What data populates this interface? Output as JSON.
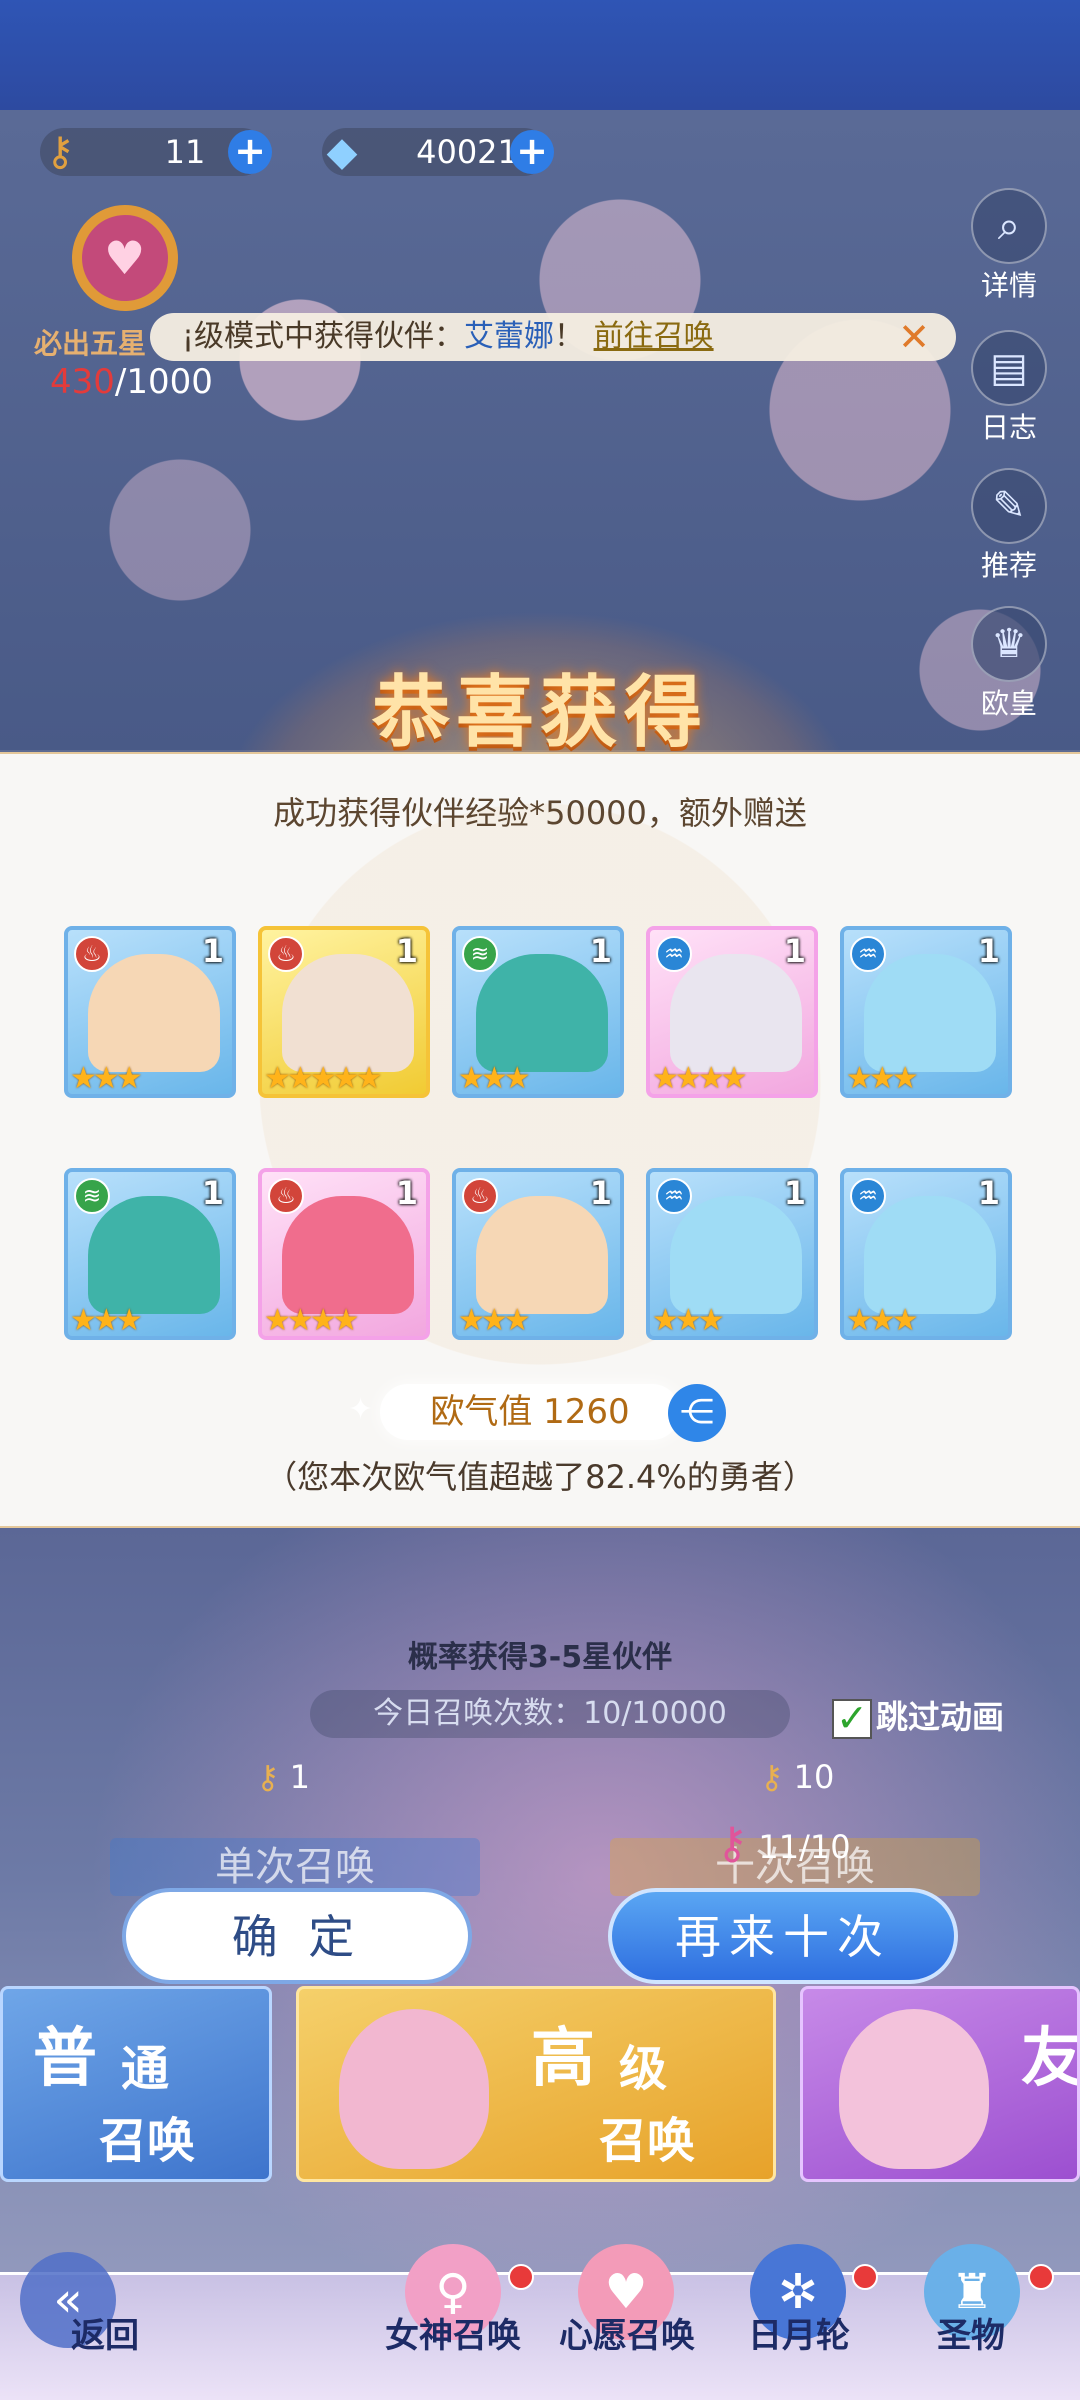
{
  "resources": {
    "summon_ticket": "11",
    "currency": "40021"
  },
  "pity": {
    "label": "必出五星",
    "current": "430",
    "total": "/1000"
  },
  "banner": {
    "prefix": "¡级模式中获得伙伴：",
    "name": "艾蕾娜",
    "exclaim": "！",
    "link": "前往召唤"
  },
  "side_buttons": [
    "详情",
    "日志",
    "推荐",
    "欧皇"
  ],
  "title": "恭喜获得",
  "subtitle": "成功获得伙伴经验*50000，额外赠送",
  "cards": [
    {
      "element": "fire",
      "count": "1",
      "stars": 3,
      "frame": "blue"
    },
    {
      "element": "fire",
      "count": "1",
      "stars": 5,
      "frame": "gold"
    },
    {
      "element": "wind",
      "count": "1",
      "stars": 3,
      "frame": "blue"
    },
    {
      "element": "water",
      "count": "1",
      "stars": 4,
      "frame": "pink"
    },
    {
      "element": "water",
      "count": "1",
      "stars": 3,
      "frame": "blue"
    },
    {
      "element": "wind",
      "count": "1",
      "stars": 3,
      "frame": "blue"
    },
    {
      "element": "fire",
      "count": "1",
      "stars": 4,
      "frame": "pink"
    },
    {
      "element": "fire",
      "count": "1",
      "stars": 3,
      "frame": "blue"
    },
    {
      "element": "water",
      "count": "1",
      "stars": 3,
      "frame": "blue"
    },
    {
      "element": "water",
      "count": "1",
      "stars": 3,
      "frame": "blue"
    }
  ],
  "luck": {
    "label": "欧气值",
    "value": "1260",
    "note": "（您本次欧气值超越了82.4%的勇者）"
  },
  "summon": {
    "probability": "概率获得3-5星伙伴",
    "daily": "今日召唤次数：10/10000",
    "skip": "跳过动画",
    "single_cost": "1",
    "ten_cost": "10",
    "single_label": "单次召唤",
    "ten_label": "十次召唤",
    "inventory": "11/10"
  },
  "buttons": {
    "confirm": "确 定",
    "again": "再来十次"
  },
  "pools": {
    "normal_a": "普",
    "normal_b": "通",
    "normal_c": "召唤",
    "advanced_a": "高",
    "advanced_b": "级",
    "advanced_c": "召唤",
    "third": "友"
  },
  "nav": [
    "返回",
    "女神召唤",
    "心愿召唤",
    "日月轮",
    "圣物"
  ],
  "colors": {
    "accent_blue": "#2f7de6",
    "gold": "#f5c338",
    "pink": "#f4a2e8",
    "red_dot": "#e83a3a"
  }
}
